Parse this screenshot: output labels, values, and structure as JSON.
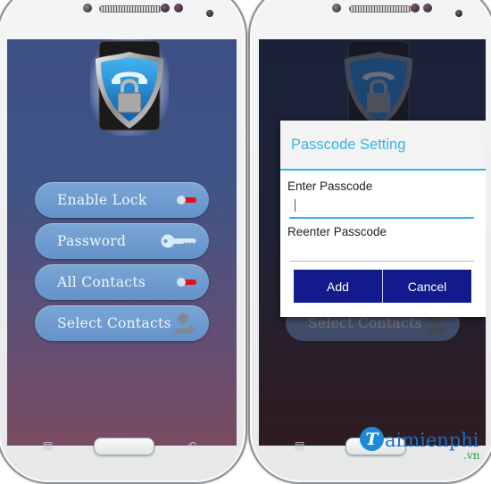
{
  "left_phone": {
    "app_logo": "shield-lock-phone-logo",
    "menu": [
      {
        "label": "Enable Lock",
        "icon": "toggle-icon",
        "state": "off"
      },
      {
        "label": "Password",
        "icon": "key-icon"
      },
      {
        "label": "All Contacts",
        "icon": "toggle-icon",
        "state": "off"
      },
      {
        "label": "Select Contacts",
        "icon": "add-contact-icon"
      }
    ]
  },
  "right_phone": {
    "background_menu_visible": {
      "label": "Select Contacts",
      "icon": "add-contact-icon"
    },
    "dialog": {
      "title": "Passcode Setting",
      "enter_label": "Enter Passcode",
      "enter_value": "",
      "reenter_label": "Reenter Passcode",
      "reenter_value": "",
      "add_label": "Add",
      "cancel_label": "Cancel"
    }
  },
  "watermark": {
    "initial": "T",
    "text": "aimienphi",
    "suffix": ".vn"
  },
  "colors": {
    "accent": "#33b5e5",
    "dialog_button": "#131a8c",
    "menu_button": "#6e9bcf",
    "toggle_off": "#e0101a"
  }
}
